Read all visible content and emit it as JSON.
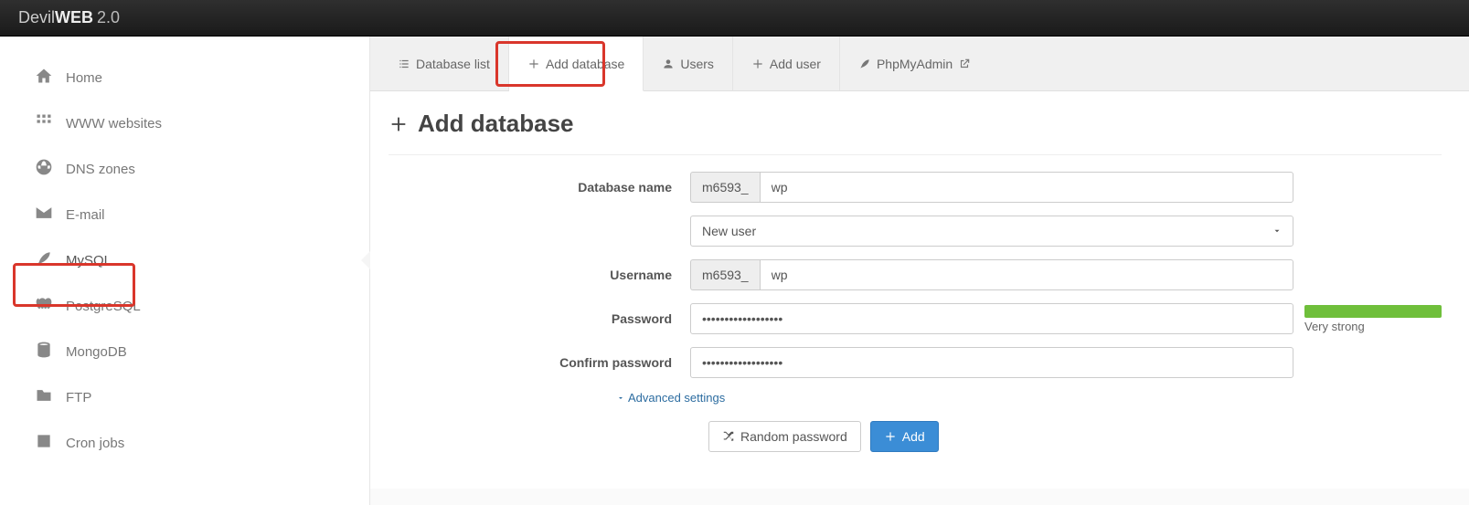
{
  "brand": {
    "light": "Devil",
    "bold": "WEB",
    "version": "2.0"
  },
  "sidebar": {
    "items": [
      {
        "label": "Home"
      },
      {
        "label": "WWW websites"
      },
      {
        "label": "DNS zones"
      },
      {
        "label": "E-mail"
      },
      {
        "label": "MySQL"
      },
      {
        "label": "PostgreSQL"
      },
      {
        "label": "MongoDB"
      },
      {
        "label": "FTP"
      },
      {
        "label": "Cron jobs"
      }
    ]
  },
  "tabs": {
    "items": [
      {
        "label": "Database list"
      },
      {
        "label": "Add database"
      },
      {
        "label": "Users"
      },
      {
        "label": "Add user"
      },
      {
        "label": "PhpMyAdmin"
      }
    ]
  },
  "page": {
    "title": "Add database",
    "labels": {
      "database_name": "Database name",
      "username": "Username",
      "password": "Password",
      "confirm_password": "Confirm password"
    },
    "prefix": "m6593_",
    "db_value": "wp",
    "user_select": "New user",
    "username_value": "wp",
    "password_value": "••••••••••••••••••",
    "confirm_value": "••••••••••••••••••",
    "strength": "Very strong",
    "advanced": "Advanced settings",
    "buttons": {
      "random": "Random password",
      "add": "Add"
    }
  }
}
